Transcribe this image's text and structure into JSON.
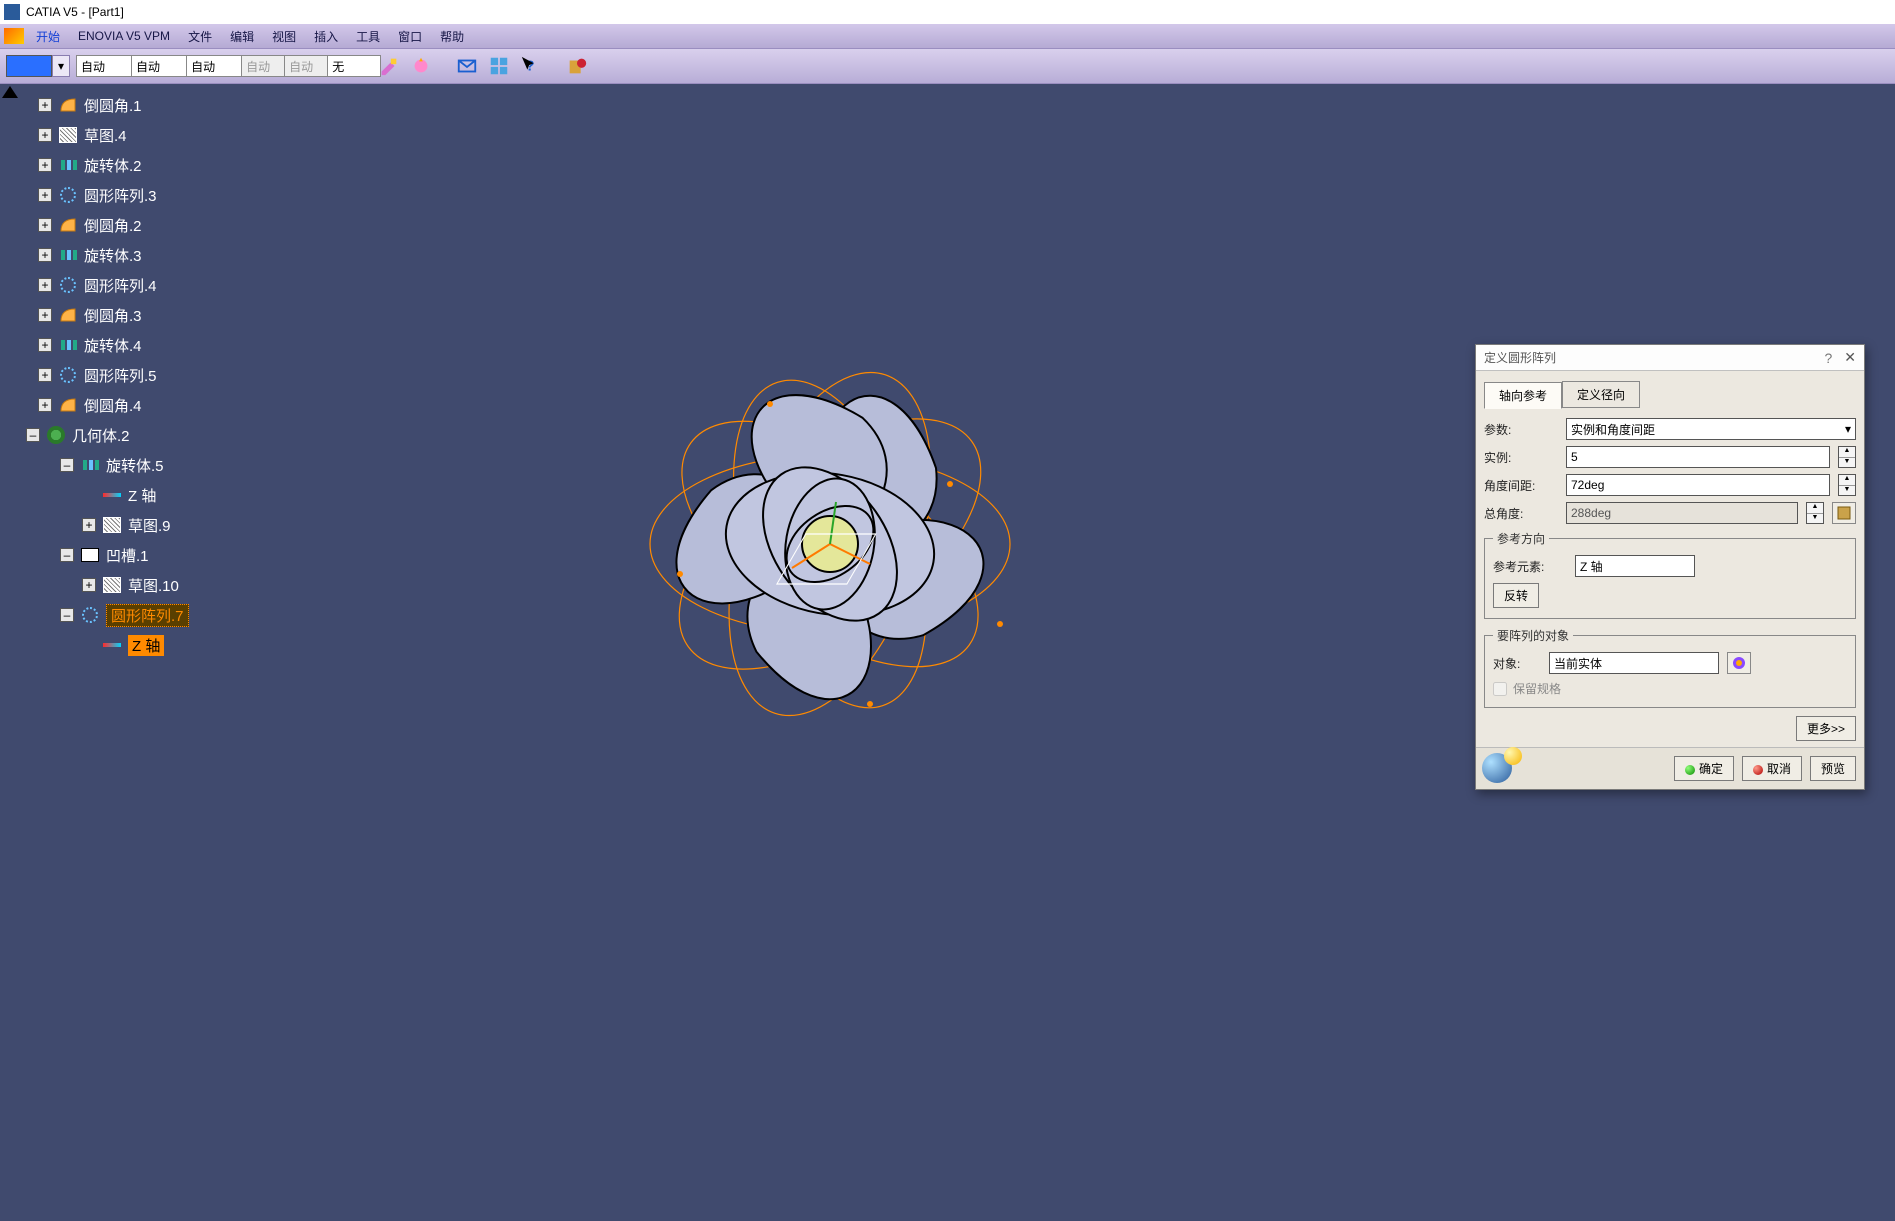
{
  "app": {
    "title": "CATIA V5 - [Part1]"
  },
  "menu": {
    "start": "开始",
    "items": [
      "ENOVIA V5 VPM",
      "文件",
      "编辑",
      "视图",
      "插入",
      "工具",
      "窗口",
      "帮助"
    ]
  },
  "toolbar": {
    "combos": [
      "自动",
      "自动",
      "自动",
      "自动",
      "自动",
      "无"
    ]
  },
  "tree": [
    {
      "lvl": 0,
      "tog": "+",
      "icon": "fillet",
      "label": "倒圆角.1"
    },
    {
      "lvl": 0,
      "tog": "+",
      "icon": "sketch",
      "label": "草图.4"
    },
    {
      "lvl": 0,
      "tog": "+",
      "icon": "shaft",
      "label": "旋转体.2"
    },
    {
      "lvl": 0,
      "tog": "+",
      "icon": "circ",
      "label": "圆形阵列.3"
    },
    {
      "lvl": 0,
      "tog": "+",
      "icon": "fillet",
      "label": "倒圆角.2"
    },
    {
      "lvl": 0,
      "tog": "+",
      "icon": "shaft",
      "label": "旋转体.3"
    },
    {
      "lvl": 0,
      "tog": "+",
      "icon": "circ",
      "label": "圆形阵列.4"
    },
    {
      "lvl": 0,
      "tog": "+",
      "icon": "fillet",
      "label": "倒圆角.3"
    },
    {
      "lvl": 0,
      "tog": "+",
      "icon": "shaft",
      "label": "旋转体.4"
    },
    {
      "lvl": 0,
      "tog": "+",
      "icon": "circ",
      "label": "圆形阵列.5"
    },
    {
      "lvl": 0,
      "tog": "+",
      "icon": "fillet",
      "label": "倒圆角.4"
    },
    {
      "lvl": 0,
      "tog": "–",
      "icon": "gear",
      "label": "几何体.2",
      "geom": true
    },
    {
      "lvl": 1,
      "tog": "–",
      "icon": "shaft",
      "label": "旋转体.5"
    },
    {
      "lvl": 2,
      "tog": "",
      "icon": "axis",
      "label": "Z 轴"
    },
    {
      "lvl": 2,
      "tog": "+",
      "icon": "sketch",
      "label": "草图.9"
    },
    {
      "lvl": 1,
      "tog": "–",
      "icon": "pocket",
      "label": "凹槽.1"
    },
    {
      "lvl": 2,
      "tog": "+",
      "icon": "sketch",
      "label": "草图.10"
    },
    {
      "lvl": 1,
      "tog": "–",
      "icon": "circ",
      "label": "圆形阵列.7",
      "sel": true
    },
    {
      "lvl": 2,
      "tog": "",
      "icon": "axis",
      "label": "Z 轴",
      "hl": true
    }
  ],
  "dialog": {
    "title": "定义圆形阵列",
    "tabs": {
      "axial": "轴向参考",
      "radial": "定义径向"
    },
    "params": {
      "param_label": "参数:",
      "param_value": "实例和角度间距",
      "instance_label": "实例:",
      "instance_value": "5",
      "angspace_label": "角度间距:",
      "angspace_value": "72deg",
      "totang_label": "总角度:",
      "totang_value": "288deg"
    },
    "ref_dir": {
      "legend": "参考方向",
      "elem_label": "参考元素:",
      "elem_value": "Z 轴",
      "reverse": "反转"
    },
    "target": {
      "legend": "要阵列的对象",
      "obj_label": "对象:",
      "obj_value": "当前实体",
      "keep_spec": "保留规格"
    },
    "more": "更多>>",
    "ok": "确定",
    "cancel": "取消",
    "preview": "预览"
  }
}
